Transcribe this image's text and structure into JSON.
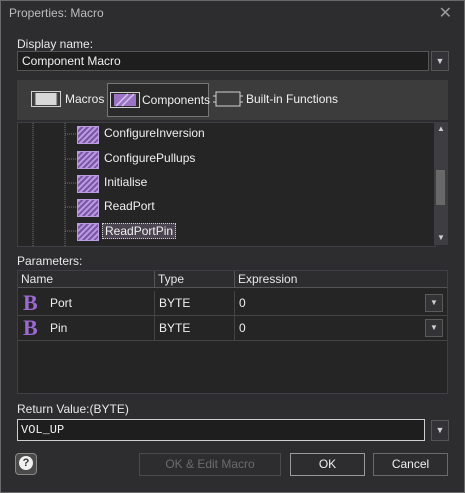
{
  "window": {
    "title": "Properties: Macro",
    "close_icon": "close-icon"
  },
  "display_name": {
    "label": "Display name:",
    "value": "Component Macro"
  },
  "tabs": [
    {
      "label": "Macros",
      "icon": "macro-icon",
      "active": false
    },
    {
      "label": "Components",
      "icon": "component-icon",
      "active": true
    },
    {
      "label": "Built-in Functions",
      "icon": "builtin-function-icon",
      "active": false
    }
  ],
  "tree": {
    "items": [
      {
        "label": "ConfigureInversion",
        "icon": "macro-icon",
        "selected": false
      },
      {
        "label": "ConfigurePullups",
        "icon": "macro-icon",
        "selected": false
      },
      {
        "label": "Initialise",
        "icon": "macro-icon",
        "selected": false
      },
      {
        "label": "ReadPort",
        "icon": "macro-icon",
        "selected": false
      },
      {
        "label": "ReadPortPin",
        "icon": "macro-icon",
        "selected": true
      }
    ]
  },
  "parameters": {
    "label": "Parameters:",
    "columns": [
      "Name",
      "Type",
      "Expression"
    ],
    "rows": [
      {
        "icon": "byte-type-icon",
        "icon_glyph": "B",
        "name": "Port",
        "type": "BYTE",
        "expression": "0"
      },
      {
        "icon": "byte-type-icon",
        "icon_glyph": "B",
        "name": "Pin",
        "type": "BYTE",
        "expression": "0"
      }
    ]
  },
  "return_value": {
    "label": "Return Value:(BYTE)",
    "value": "VOL_UP"
  },
  "buttons": {
    "help_glyph": "?",
    "ok_edit": "OK & Edit Macro",
    "ok": "OK",
    "cancel": "Cancel"
  },
  "colors": {
    "background": "#2d2d30",
    "accent": "#9b6ad0"
  }
}
